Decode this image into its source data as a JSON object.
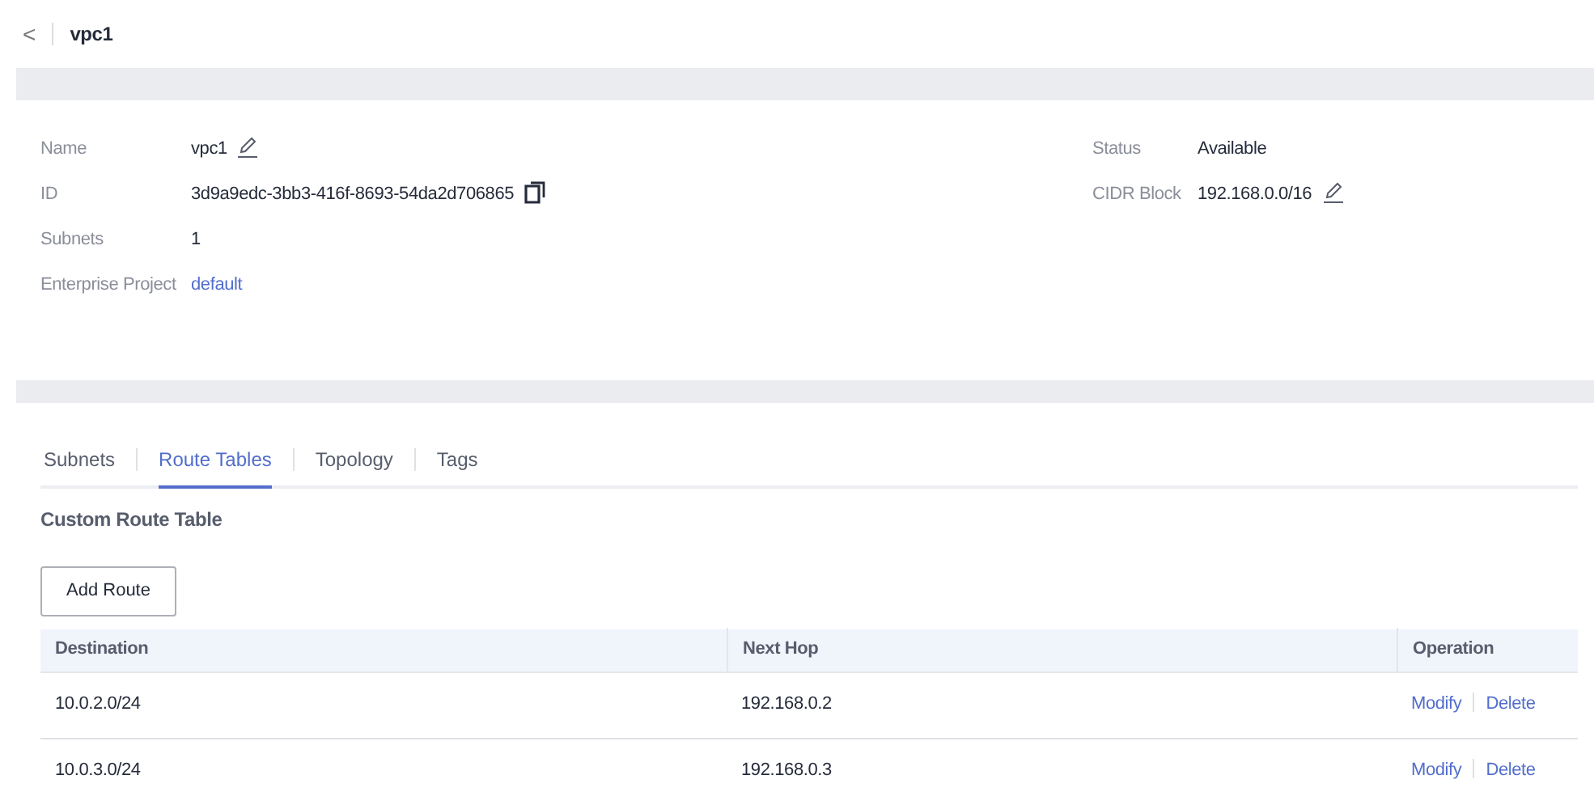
{
  "header": {
    "back": "<",
    "title": "vpc1"
  },
  "details": {
    "left": [
      {
        "label": "Name",
        "value": "vpc1",
        "kind": "editable"
      },
      {
        "label": "ID",
        "value": "3d9a9edc-3bb3-416f-8693-54da2d706865",
        "kind": "copyable"
      },
      {
        "label": "Subnets",
        "value": "1",
        "kind": "plain"
      },
      {
        "label": "Enterprise Project",
        "value": "default",
        "kind": "link"
      }
    ],
    "right": [
      {
        "label": "Status",
        "value": "Available",
        "kind": "plain"
      },
      {
        "label": "CIDR Block",
        "value": "192.168.0.0/16",
        "kind": "editable"
      }
    ]
  },
  "tabs": [
    {
      "label": "Subnets",
      "selected": false
    },
    {
      "label": "Route Tables",
      "selected": true
    },
    {
      "label": "Topology",
      "selected": false
    },
    {
      "label": "Tags",
      "selected": false
    }
  ],
  "section_title": "Custom Route Table",
  "add_button": "Add Route",
  "table": {
    "columns": [
      "Destination",
      "Next Hop",
      "Operation"
    ],
    "rows": [
      {
        "destination": "10.0.2.0/24",
        "next_hop": "192.168.0.2",
        "actions": [
          "Modify",
          "Delete"
        ]
      },
      {
        "destination": "10.0.3.0/24",
        "next_hop": "192.168.0.3",
        "actions": [
          "Modify",
          "Delete"
        ]
      }
    ]
  }
}
